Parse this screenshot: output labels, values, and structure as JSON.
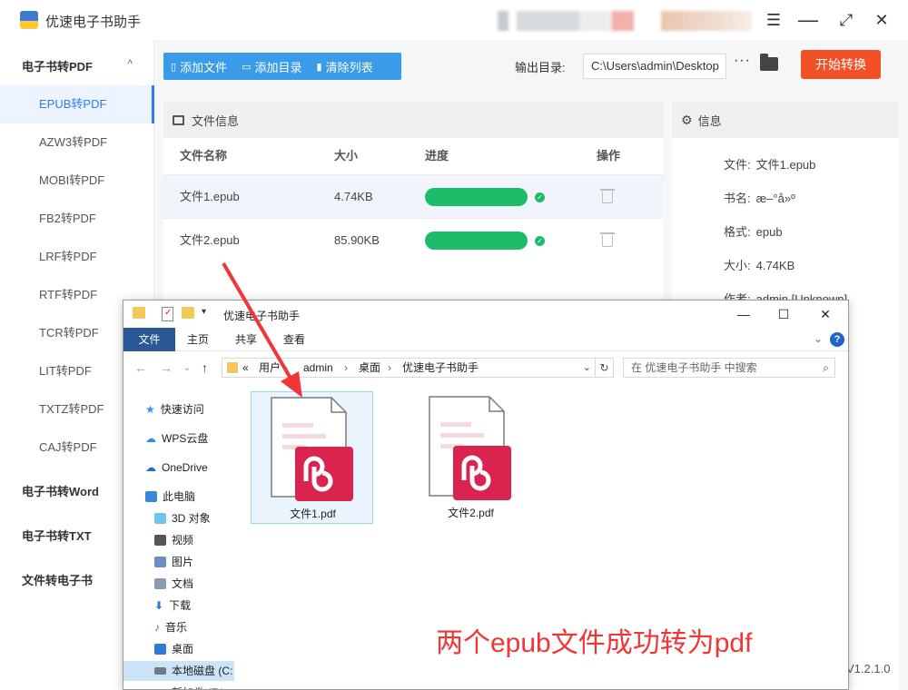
{
  "app": {
    "title": "优速电子书助手",
    "version": "V1.2.1.0"
  },
  "window_controls": {
    "menu": "☰",
    "maximize": "⤢",
    "close": "✕"
  },
  "sidebar": {
    "groups": [
      {
        "label": "电子书转PDF",
        "expanded": true
      },
      {
        "label": "电子书转Word",
        "expanded": false
      },
      {
        "label": "电子书转TXT",
        "expanded": false
      },
      {
        "label": "文件转电子书",
        "expanded": false
      }
    ],
    "items": [
      "EPUB转PDF",
      "AZW3转PDF",
      "MOBI转PDF",
      "FB2转PDF",
      "LRF转PDF",
      "RTF转PDF",
      "TCR转PDF",
      "LIT转PDF",
      "TXTZ转PDF",
      "CAJ转PDF"
    ],
    "active_item": "EPUB转PDF"
  },
  "toolbar": {
    "add_file": "添加文件",
    "add_dir": "添加目录",
    "clear_list": "清除列表"
  },
  "output": {
    "label": "输出目录:",
    "path": "C:\\Users\\admin\\Desktop",
    "more": "···",
    "start_button": "开始转换"
  },
  "file_panel": {
    "title": "文件信息",
    "columns": {
      "name": "文件名称",
      "size": "大小",
      "progress": "进度",
      "action": "操作"
    },
    "rows": [
      {
        "name": "文件1.epub",
        "size": "4.74KB",
        "progress": 1.0
      },
      {
        "name": "文件2.epub",
        "size": "85.90KB",
        "progress": 1.0
      }
    ]
  },
  "info_panel": {
    "title": "信息",
    "rows": [
      {
        "label": "文件:",
        "value": "文件1.epub"
      },
      {
        "label": "书名:",
        "value": "æ–°å»º"
      },
      {
        "label": "格式:",
        "value": "epub"
      },
      {
        "label": "大小:",
        "value": "4.74KB"
      },
      {
        "label": "作者:",
        "value": "admin [Unknown]"
      }
    ]
  },
  "explorer": {
    "title": "优速电子书助手",
    "ribbon_tabs": [
      "文件",
      "主页",
      "共享",
      "查看"
    ],
    "address": {
      "prefix": "«",
      "parts": [
        "用户",
        "admin",
        "桌面",
        "优速电子书助手"
      ]
    },
    "search_placeholder": "在 优速电子书助手 中搜索",
    "nav_items": [
      {
        "label": "快速访问",
        "icon": "star-icon",
        "color": "#3c8ee6"
      },
      {
        "label": "WPS云盘",
        "icon": "cloud-icon",
        "color": "#2b8be8"
      },
      {
        "label": "OneDrive",
        "icon": "onedrive-icon",
        "color": "#1c6fd2"
      },
      {
        "label": "此电脑",
        "icon": "pc-icon",
        "color": "#3a86d9"
      },
      {
        "label": "3D 对象",
        "icon": "cube-icon",
        "color": "#6cc6e8"
      },
      {
        "label": "视频",
        "icon": "video-icon",
        "color": "#555555"
      },
      {
        "label": "图片",
        "icon": "picture-icon",
        "color": "#6b8fbf"
      },
      {
        "label": "文档",
        "icon": "document-icon",
        "color": "#8a9bb0"
      },
      {
        "label": "下载",
        "icon": "download-icon",
        "color": "#2f7ad9"
      },
      {
        "label": "音乐",
        "icon": "music-icon",
        "color": "#2f7ad9"
      },
      {
        "label": "桌面",
        "icon": "desktop-icon",
        "color": "#2f7ad9"
      },
      {
        "label": "本地磁盘 (C:",
        "icon": "drive-icon",
        "color": "#6e7b87"
      },
      {
        "label": "新加卷 (E:)",
        "icon": "drive-icon",
        "color": "#6e7b87"
      }
    ],
    "files": [
      {
        "name": "文件1.pdf",
        "selected": true
      },
      {
        "name": "文件2.pdf",
        "selected": false
      }
    ]
  },
  "annotation": {
    "text": "两个epub文件成功转为pdf",
    "color": "#f03636"
  },
  "colors": {
    "accent": "#2f7cf6",
    "toolbar": "#3a9be8",
    "start": "#f25128",
    "success": "#1dbc6b",
    "pdf": "#d8244f"
  }
}
